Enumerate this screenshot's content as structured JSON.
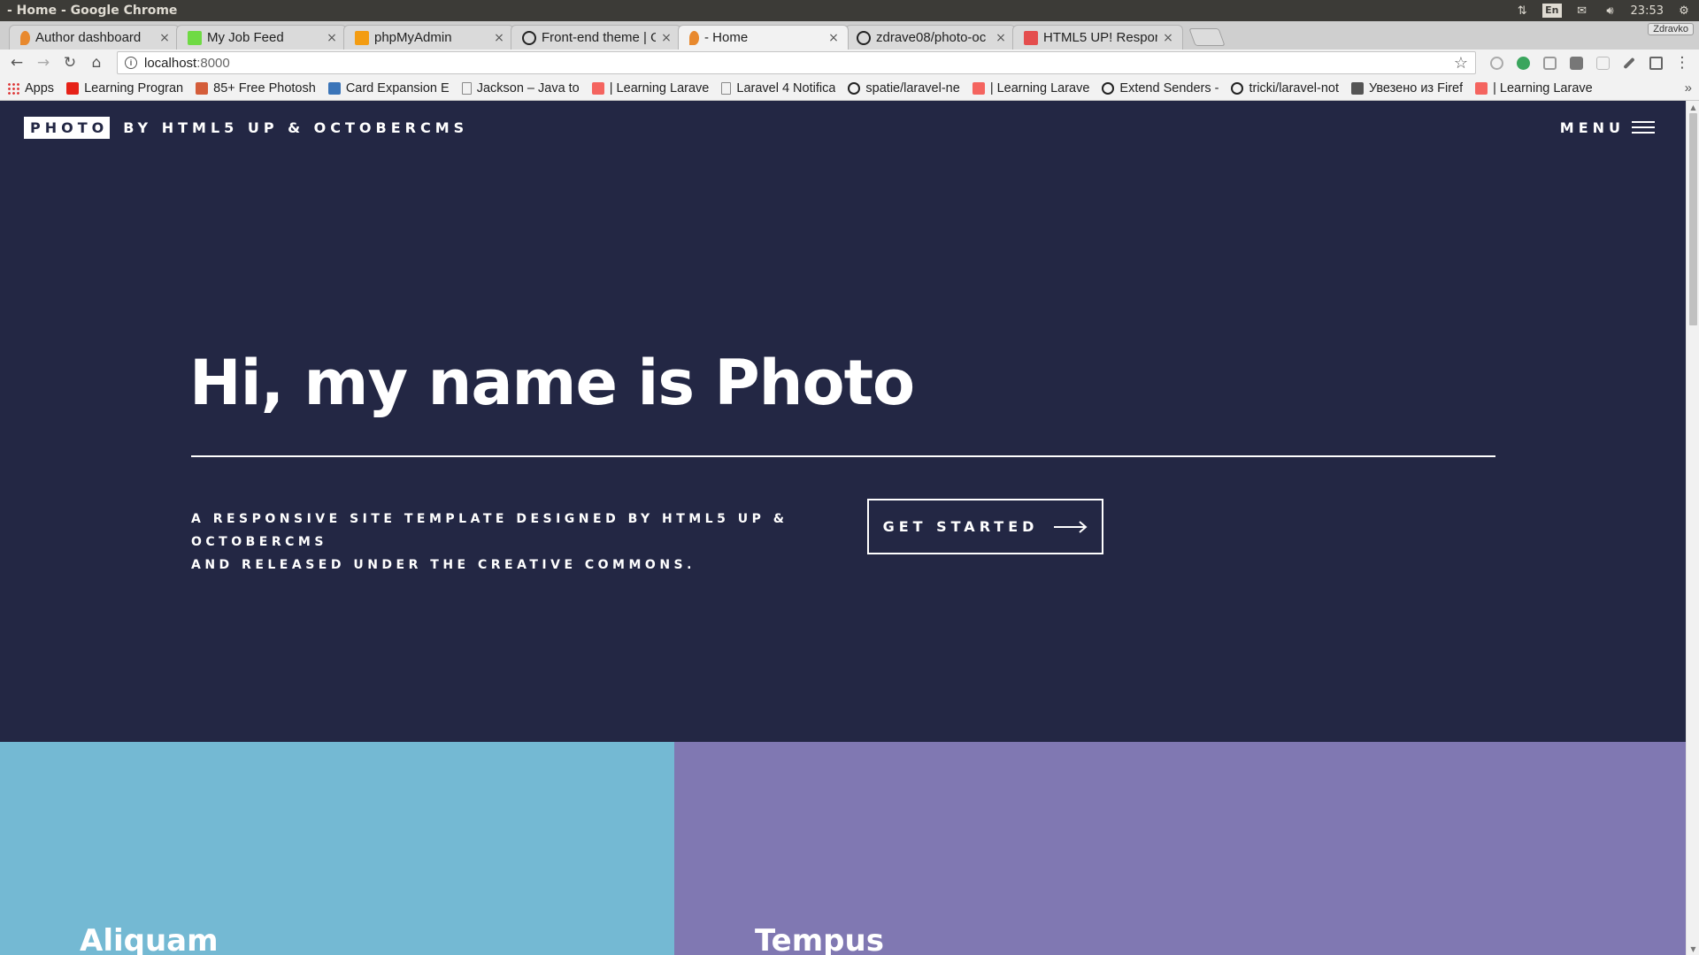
{
  "os": {
    "window_title": "- Home - Google Chrome",
    "lang": "En",
    "time": "23:53"
  },
  "browser": {
    "profile": "Zdravko",
    "tabs": [
      {
        "title": "Author dashboard",
        "favicon": "octobercms-icon",
        "color": "#e8892e"
      },
      {
        "title": "My Job Feed",
        "favicon": "upwork-icon",
        "color": "#6fda44"
      },
      {
        "title": "phpMyAdmin",
        "favicon": "phpmyadmin-icon",
        "color": "#f39c12"
      },
      {
        "title": "Front-end theme | O",
        "favicon": "github-icon",
        "color": "#222222"
      },
      {
        "title": "- Home",
        "favicon": "octobercms-icon",
        "color": "#e8892e",
        "active": true
      },
      {
        "title": "zdrave08/photo-oc",
        "favicon": "github-icon",
        "color": "#222222"
      },
      {
        "title": "HTML5 UP! Respon",
        "favicon": "html5up-icon",
        "color": "#e44d4d"
      }
    ],
    "url_host": "localhost",
    "url_port": ":8000",
    "bookmarks": [
      {
        "label": "Apps",
        "icon": "apps-grid-icon",
        "color": "#555555"
      },
      {
        "label": "Learning Progran",
        "icon": "youtube-icon",
        "color": "#e62117"
      },
      {
        "label": "85+ Free Photosh",
        "icon": "tuts-icon",
        "color": "#d45d3a"
      },
      {
        "label": "Card Expansion E",
        "icon": "bookmark-icon",
        "color": "#3a74b8"
      },
      {
        "label": "Jackson – Java to",
        "icon": "page-icon",
        "color": "#888888"
      },
      {
        "label": "| Learning Larave",
        "icon": "laravel-icon",
        "color": "#f4645f"
      },
      {
        "label": "Laravel 4 Notifica",
        "icon": "page-icon",
        "color": "#888888"
      },
      {
        "label": "spatie/laravel-ne",
        "icon": "github-icon",
        "color": "#222222"
      },
      {
        "label": "| Learning Larave",
        "icon": "laravel-icon",
        "color": "#f4645f"
      },
      {
        "label": "Extend Senders -",
        "icon": "github-icon",
        "color": "#222222"
      },
      {
        "label": "tricki/laravel-not",
        "icon": "github-icon",
        "color": "#222222"
      },
      {
        "label": "Увезено из Firef",
        "icon": "folder-icon",
        "color": "#555555"
      },
      {
        "label": "| Learning Larave",
        "icon": "laravel-icon",
        "color": "#f4645f"
      }
    ],
    "bookmarks_more": "»"
  },
  "site": {
    "logo": "PHOTO",
    "logo_by": "BY HTML5 UP & OCTOBERCMS",
    "menu_label": "MENU",
    "hero_title": "Hi, my name is Photo",
    "hero_sub_line1": "A RESPONSIVE SITE TEMPLATE DESIGNED BY HTML5 UP & OCTOBERCMS",
    "hero_sub_line2": "AND RELEASED UNDER THE CREATIVE COMMONS.",
    "cta_label": "GET STARTED",
    "panels": [
      {
        "title": "Aliquam",
        "color": "#74b9d3"
      },
      {
        "title": "Tempus",
        "color": "#8078b2"
      }
    ],
    "bg_color": "#232744"
  }
}
